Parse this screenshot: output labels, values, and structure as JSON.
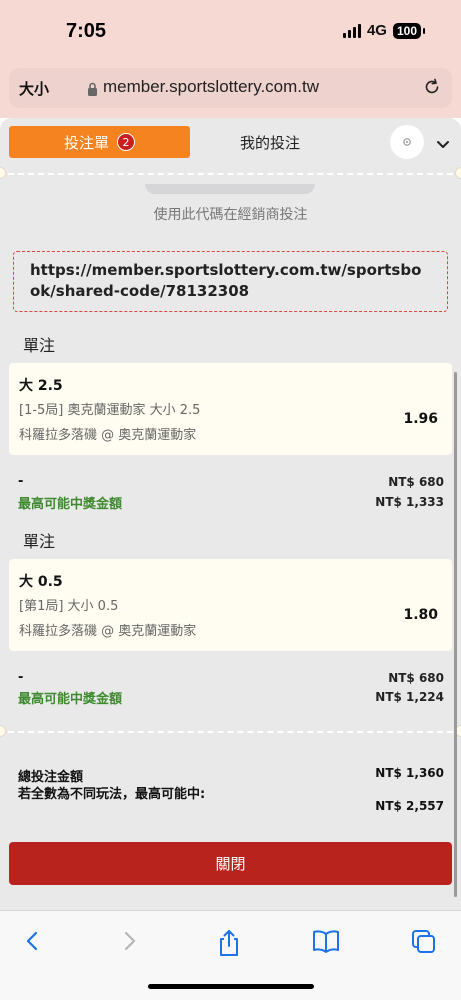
{
  "status_bar": {
    "time": "7:05",
    "network": "4G",
    "battery": "100"
  },
  "url_bar": {
    "text_size": "大小",
    "url": "member.sportslottery.com.tw"
  },
  "tabs": {
    "bet_slip": "投注單",
    "bet_count": "2",
    "my_bets": "我的投注"
  },
  "share": {
    "caption": "使用此代碼在經銷商投注",
    "link": "https://member.sportslottery.com.tw/sportsbook/shared-code/78132308"
  },
  "bets": [
    {
      "section": "單注",
      "selection": "大 2.5",
      "market": "[1-5局] 奧克蘭運動家 大小 2.5",
      "event": "科羅拉多落磯 @ 奧克蘭運動家",
      "odds": "1.96",
      "stake_label": "-",
      "stake": "NT$ 680",
      "max_win_label": "最高可能中獎金額",
      "max_win": "NT$ 1,333"
    },
    {
      "section": "單注",
      "selection": "大 0.5",
      "market": "[第1局] 大小 0.5",
      "event": "科羅拉多落磯 @ 奧克蘭運動家",
      "odds": "1.80",
      "stake_label": "-",
      "stake": "NT$ 680",
      "max_win_label": "最高可能中獎金額",
      "max_win": "NT$ 1,224"
    }
  ],
  "summary": {
    "total_label": "總投注金額",
    "total": "NT$ 1,360",
    "all_diff_label": "若全數為不同玩法，最高可能中:",
    "all_diff": "NT$ 2,557"
  },
  "close_label": "關閉",
  "colors": {
    "orange": "#f58320",
    "red": "#b8231e",
    "green": "#3f8a2f",
    "card": "#fffcf1"
  },
  "toolbar_icons": [
    "back-icon",
    "forward-icon",
    "share-icon",
    "bookmarks-icon",
    "tabs-icon"
  ]
}
